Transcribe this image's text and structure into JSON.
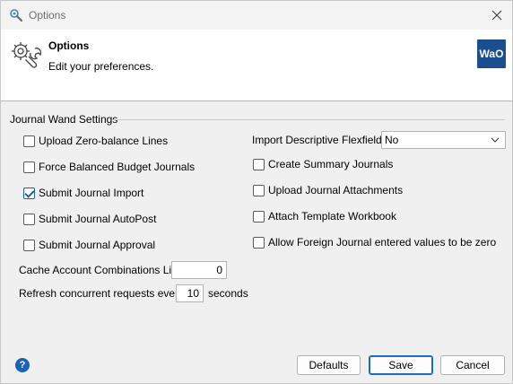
{
  "window": {
    "title": "Options"
  },
  "header": {
    "title": "Options",
    "subtitle": "Edit your preferences.",
    "logo_text": "WaO",
    "logo_color": "#1a4e8f"
  },
  "group": {
    "label": "Journal Wand Settings"
  },
  "left_options": [
    {
      "label": "Upload Zero-balance Lines",
      "checked": false
    },
    {
      "label": "Force Balanced Budget Journals",
      "checked": false
    },
    {
      "label": "Submit Journal Import",
      "checked": true
    },
    {
      "label": "Submit Journal AutoPost",
      "checked": false
    },
    {
      "label": "Submit Journal Approval",
      "checked": false
    }
  ],
  "flexfields": {
    "label": "Import Descriptive Flexfields",
    "selected": "No"
  },
  "right_options": [
    {
      "label": "Create Summary Journals",
      "checked": false
    },
    {
      "label": "Upload Journal Attachments",
      "checked": false
    },
    {
      "label": "Attach Template Workbook",
      "checked": false
    },
    {
      "label": "Allow Foreign Journal entered values to be zero",
      "checked": false
    }
  ],
  "cache": {
    "label": "Cache Account Combinations Limit",
    "value": "0"
  },
  "refresh": {
    "label": "Refresh concurrent requests every",
    "value": "10",
    "unit": "seconds"
  },
  "buttons": {
    "defaults": "Defaults",
    "save": "Save",
    "cancel": "Cancel"
  },
  "icons": {
    "app": "wrench-gear-icon",
    "close": "close-icon",
    "help": "help-icon",
    "dropdown": "chevron-down-icon"
  },
  "help_glyph": "?"
}
